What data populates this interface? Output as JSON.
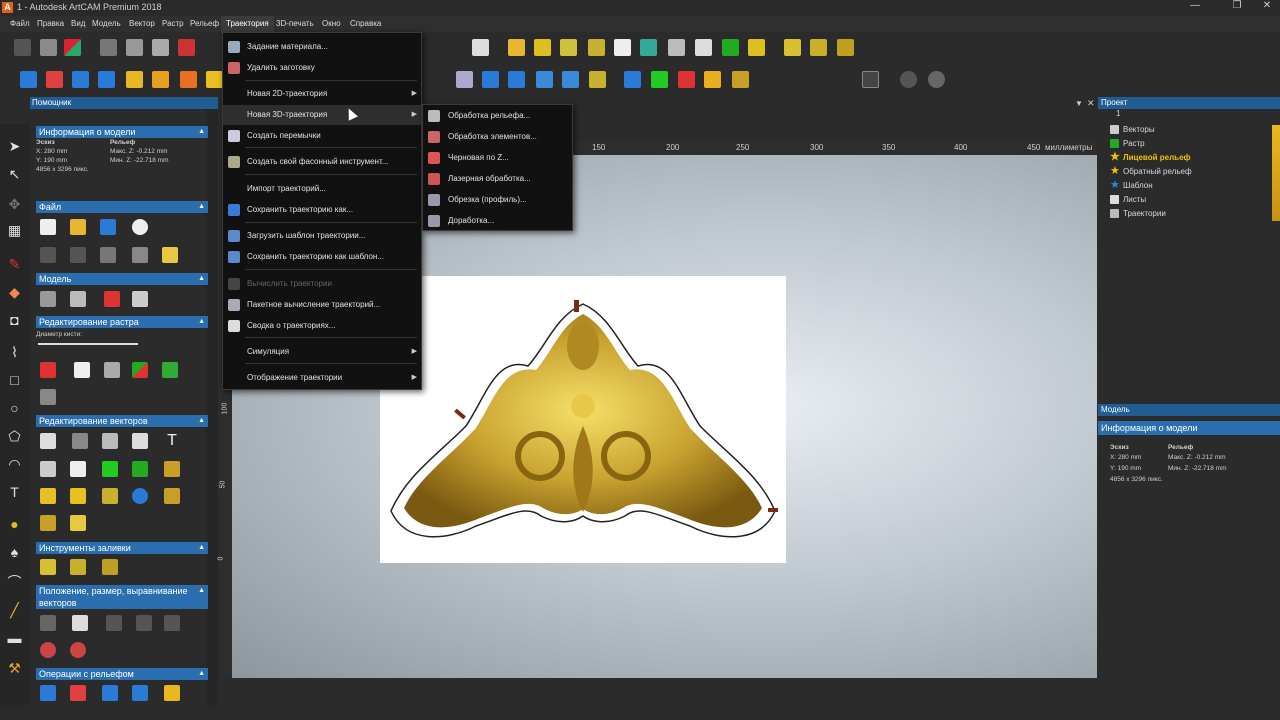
{
  "window": {
    "title": "1 - Autodesk ArtCAM Premium 2018",
    "icon": "artcam-logo-icon",
    "controls": [
      "—",
      "❐",
      "✕"
    ]
  },
  "menubar": [
    "Файл",
    "Правка",
    "Вид",
    "Модель",
    "Вектор",
    "Растр",
    "Рельеф",
    "Траектория",
    "3D-печать",
    "Окно",
    "Справка"
  ],
  "menubar_active": "Траектория",
  "trajectory_menu": {
    "items": [
      {
        "label": "Задание материала...",
        "icon": "material-setup-icon",
        "submenu": false
      },
      {
        "label": "Удалить заготовку",
        "icon": "delete-block-icon",
        "submenu": false
      },
      {
        "label": "Новая 2D-траектория",
        "icon": "",
        "submenu": true
      },
      {
        "label": "Новая 3D-траектория",
        "icon": "",
        "submenu": true
      },
      {
        "label": "Создать перемычки",
        "icon": "bridges-icon",
        "submenu": false
      },
      {
        "label": "Создать свой фасонный инструмент...",
        "icon": "form-tool-icon",
        "submenu": false
      },
      {
        "label": "Импорт траекторий...",
        "icon": "",
        "submenu": false
      },
      {
        "label": "Сохранить траекторию как...",
        "icon": "save-toolpath-icon",
        "submenu": false
      },
      {
        "label": "Загрузить шаблон траектории...",
        "icon": "load-template-icon",
        "submenu": false
      },
      {
        "label": "Сохранить траекторию как шаблон...",
        "icon": "save-template-icon",
        "submenu": false
      },
      {
        "label": "Вычислить траектории",
        "icon": "calculate-icon",
        "submenu": false,
        "disabled": true
      },
      {
        "label": "Пакетное вычисление траекторий...",
        "icon": "batch-calc-icon",
        "submenu": false
      },
      {
        "label": "Сводка о траекториях...",
        "icon": "summary-icon",
        "submenu": false
      },
      {
        "label": "Симуляция",
        "icon": "",
        "submenu": true
      },
      {
        "label": "Отображение траектории",
        "icon": "",
        "submenu": true
      }
    ]
  },
  "submenu_3d": {
    "items": [
      {
        "label": "Обработка рельефа...",
        "icon": "relief-machining-icon"
      },
      {
        "label": "Обработка элементов...",
        "icon": "feature-machining-icon"
      },
      {
        "label": "Черновая по Z...",
        "icon": "z-roughing-icon"
      },
      {
        "label": "Лазерная обработка...",
        "icon": "laser-machining-icon"
      },
      {
        "label": "Обрезка (профиль)...",
        "icon": "profile-trim-icon"
      },
      {
        "label": "Доработка...",
        "icon": "rest-machining-icon"
      }
    ]
  },
  "assistant": {
    "title": "Помощник",
    "model_info": {
      "title": "Информация о модели",
      "col1_head": "Эскиз",
      "col2_head": "Рельеф",
      "x": "X: 280 mm",
      "y": "Y: 190 mm",
      "pixels": "4856 x 3296 пикс.",
      "max_z": "Макс. Z: -0.212 mm",
      "min_z": "Мин. Z: -22.718 mm"
    },
    "sections": {
      "file": "Файл",
      "model": "Модель",
      "raster_edit": "Редактирование растра",
      "brush_diameter": "Диаметр кисти:",
      "vector_edit": "Редактирование векторов",
      "fill_tools": "Инструменты заливки",
      "position": "Положение, размер, выравнивание векторов",
      "relief_ops": "Операции с рельефом"
    }
  },
  "ruler": {
    "units": "миллиметры",
    "top_ticks": [
      "150",
      "200",
      "250",
      "300",
      "350",
      "400",
      "450"
    ],
    "left_ticks": [
      "100",
      "50",
      "0"
    ]
  },
  "project": {
    "title": "Проект",
    "root": "1",
    "items": [
      {
        "label": "Векторы",
        "icon": "vectors-icon",
        "highlight": false
      },
      {
        "label": "Растр",
        "icon": "raster-icon",
        "highlight": false
      },
      {
        "label": "Лицевой рельеф",
        "icon": "star-icon",
        "highlight": true
      },
      {
        "label": "Обратный рельеф",
        "icon": "star-icon",
        "highlight": false
      },
      {
        "label": "Шаблон",
        "icon": "template-icon",
        "highlight": false
      },
      {
        "label": "Листы",
        "icon": "sheets-icon",
        "highlight": false
      },
      {
        "label": "Траектории",
        "icon": "toolpaths-icon",
        "highlight": false
      }
    ]
  },
  "model_panel": {
    "title": "Модель",
    "info_title": "Информация о модели",
    "col1_head": "Эскиз",
    "col2_head": "Рельеф",
    "x": "X: 280 mm",
    "y": "Y: 190 mm",
    "pixels": "4856 x 3296 пикс.",
    "max_z": "Макс. Z: -0.212 mm",
    "min_z": "Мин. Z: -22.718 mm"
  },
  "colors": {
    "accent": "#2a6eb0",
    "panel_header": "#1f5d94",
    "menu_bg": "#111111",
    "gold": "#c9a230"
  }
}
